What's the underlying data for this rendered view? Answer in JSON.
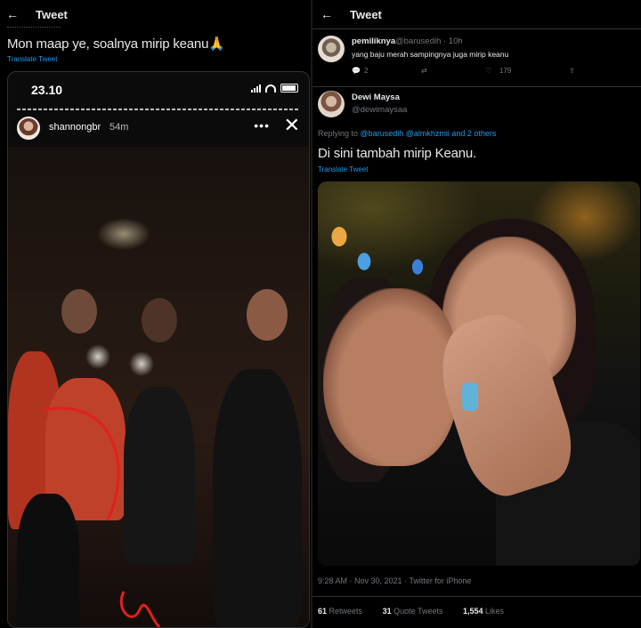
{
  "left": {
    "header_title": "Tweet",
    "tweet_text": "Mon maap ye, soalnya mirip keanu🙏",
    "translate_label": "Translate Tweet",
    "story": {
      "status_time": "23.10",
      "username": "shannongbr",
      "age": "54m",
      "more_label": "•••",
      "close_label": "✕"
    }
  },
  "right": {
    "header_title": "Tweet",
    "reply": {
      "name": "pemiliknya",
      "handle": "@barusedih · 10h",
      "text": "yang baju merah sampingnya juga mirip keanu",
      "reply_count": "2",
      "like_count": "179"
    },
    "main": {
      "name": "Dewi Maysa",
      "handle": "@dewimaysaa",
      "replying_prefix": "Replying to",
      "replying_to": "@barusedih @almkhzmii and 2 others",
      "text": "Di sini tambah mirip Keanu.",
      "translate_label": "Translate Tweet",
      "meta": "9:28 AM · Nov 30, 2021 · Twitter for iPhone",
      "retweets_count": "61",
      "retweets_label": "Retweets",
      "quotes_count": "31",
      "quotes_label": "Quote Tweets",
      "likes_count": "1,554",
      "likes_label": "Likes"
    }
  },
  "colors": {
    "background": "#000000",
    "text": "#e7e9ea",
    "secondary": "#71767b",
    "link": "#1d9bf0",
    "annotation_red": "#e0201c"
  },
  "icons": [
    "back-arrow-icon",
    "reply-icon",
    "retweet-icon",
    "like-icon",
    "share-icon",
    "more-icon",
    "close-icon",
    "signal-icon",
    "wifi-icon",
    "battery-icon"
  ]
}
